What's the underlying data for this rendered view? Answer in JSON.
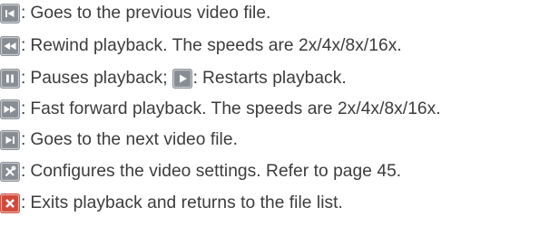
{
  "items": [
    {
      "icon": "skip-previous-icon",
      "text": "Goes to the previous video file."
    },
    {
      "icon": "rewind-icon",
      "text": "Rewind playback. The speeds are 2x/4x/8x/16x."
    },
    {
      "icon": "pause-icon",
      "text": "Pauses playback;",
      "icon2": "play-icon",
      "text2": "Restarts playback."
    },
    {
      "icon": "fast-forward-icon",
      "text": "Fast forward playback. The speeds are 2x/4x/8x/16x."
    },
    {
      "icon": "skip-next-icon",
      "text": "Goes to the next video file."
    },
    {
      "icon": "settings-tools-icon",
      "text": "Configures the video settings. Refer to page 45."
    },
    {
      "icon": "exit-close-icon",
      "text": "Exits playback and returns to the file list."
    }
  ],
  "separator": ":",
  "colors": {
    "icon_background": "#888d93",
    "exit_icon_background": "#cf4a3c",
    "text": "#3c3c3c"
  }
}
